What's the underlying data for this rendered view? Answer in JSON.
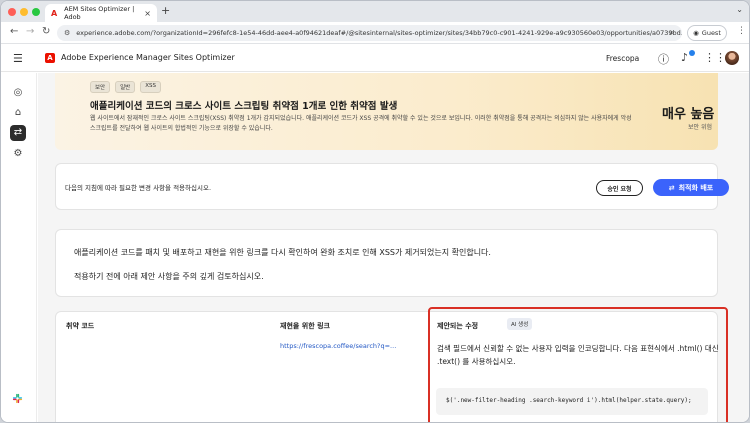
{
  "browser": {
    "tab_title": "AEM Sites Optimizer | Adob",
    "url": "experience.adobe.com/?organizationId=296fefc8-1e54-46dd-aee4-a0f94621deaf#/@sitesinternal/sites-optimizer/sites/34bb79c0-c901-4241-929e-a9c930560e03/opportunities/a0739bd...",
    "profile_label": "Guest"
  },
  "app": {
    "title": "Adobe Experience Manager Sites Optimizer",
    "org_name": "Frescopa"
  },
  "banner": {
    "tags": [
      "보안",
      "일반",
      "XSS"
    ],
    "title": "애플리케이션 코드의 크로스 사이트 스크립팅 취약점 1개로 인한 취약점 발생",
    "description": "웹 사이트에서 잠재적인 크로스 사이트 스크립팅(XSS) 취약점 1개가 감지되었습니다. 애플리케이션 코드가 XSS 공격에 취약할 수 있는 것으로 보입니다. 이러한 취약점을 통해 공격자는 의심하지 않는 사용자에게 악성 스크립트를 전달하여 웹 사이트의 합법적인 기능으로 위장할 수 있습니다.",
    "severity": "매우 높음",
    "severity_sub": "보안 위험"
  },
  "action_card": {
    "text": "다음의 지침에 따라 필요한 변경 사항을 적용하십시오.",
    "approve_label": "승인 요청",
    "deploy_label": "최적화 배포"
  },
  "info_card": {
    "line1": "애플리케이션 코드를 패치 및 배포하고 재현을 위한 링크를 다시 확인하여 완화 조치로 인해 XSS가 제거되었는지 확인합니다.",
    "line2": "적용하기 전에 아래 제안 사항을 주의 깊게 검토하십시오."
  },
  "table": {
    "col_code": "취약 코드",
    "col_link": "재현을 위한 링크",
    "col_fix": "제안되는 수정",
    "ai_badge": "AI 생성",
    "link_text": "https://frescopa.coffee/search?q=...",
    "suggestion": "검색 필드에서 신뢰할 수 없는 사용자 입력을 인코딩합니다. 다음 표현식에서 .html() 대신 .text() 를 사용하십시오.",
    "code": "$('.new-filter-heading .search-keyword i').html(helper.state.query);"
  },
  "colors": {
    "accent": "#3b63fb",
    "highlight": "#d93025",
    "adobe_red": "#eb1000"
  }
}
